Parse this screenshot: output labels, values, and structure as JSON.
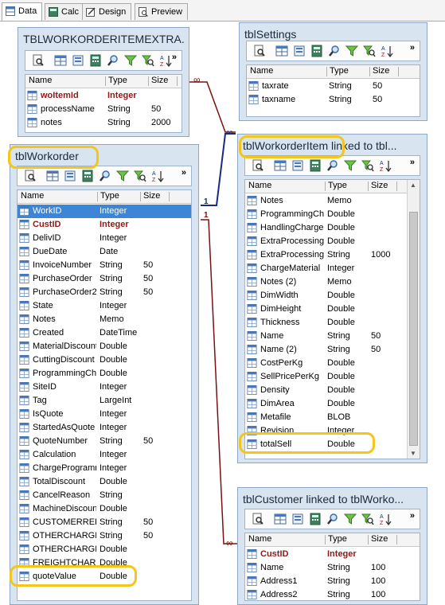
{
  "tabs": [
    {
      "label": "Data",
      "icon": "data-tab-icon"
    },
    {
      "label": "Calc",
      "icon": "calc-tab-icon"
    },
    {
      "label": "Design",
      "icon": "design-tab-icon"
    },
    {
      "label": "Preview",
      "icon": "preview-tab-icon"
    }
  ],
  "active_tab": "Data",
  "columns": {
    "name": "Name",
    "type": "Type",
    "size": "Size"
  },
  "toolbar_more": "»",
  "tables": {
    "itemextra": {
      "title": "TBLWORKORDERITEMEXTRA...",
      "rows": [
        {
          "name": "woItemId",
          "type": "Integer",
          "size": "",
          "key": true
        },
        {
          "name": "processName",
          "type": "String",
          "size": "50"
        },
        {
          "name": "notes",
          "type": "String",
          "size": "2000"
        }
      ]
    },
    "settings": {
      "title": "tblSettings",
      "rows": [
        {
          "name": "taxrate",
          "type": "String",
          "size": "50"
        },
        {
          "name": "taxname",
          "type": "String",
          "size": "50"
        }
      ]
    },
    "workorder": {
      "title": "tblWorkorder",
      "rows": [
        {
          "name": "WorkID",
          "type": "Integer",
          "size": "",
          "selected": true
        },
        {
          "name": "CustID",
          "type": "Integer",
          "size": "",
          "key": true
        },
        {
          "name": "DelivID",
          "type": "Integer",
          "size": ""
        },
        {
          "name": "DueDate",
          "type": "Date",
          "size": ""
        },
        {
          "name": "InvoiceNumber",
          "type": "String",
          "size": "50"
        },
        {
          "name": "PurchaseOrder",
          "type": "String",
          "size": "50"
        },
        {
          "name": "PurchaseOrder2",
          "type": "String",
          "size": "50"
        },
        {
          "name": "State",
          "type": "Integer",
          "size": ""
        },
        {
          "name": "Notes",
          "type": "Memo",
          "size": ""
        },
        {
          "name": "Created",
          "type": "DateTime",
          "size": ""
        },
        {
          "name": "MaterialDiscount",
          "type": "Double",
          "size": ""
        },
        {
          "name": "CuttingDiscount",
          "type": "Double",
          "size": ""
        },
        {
          "name": "ProgrammingCha",
          "type": "Double",
          "size": ""
        },
        {
          "name": "SiteID",
          "type": "Integer",
          "size": ""
        },
        {
          "name": "Tag",
          "type": "LargeInt",
          "size": ""
        },
        {
          "name": "IsQuote",
          "type": "Integer",
          "size": ""
        },
        {
          "name": "StartedAsQuote",
          "type": "Integer",
          "size": ""
        },
        {
          "name": "QuoteNumber",
          "type": "String",
          "size": "50"
        },
        {
          "name": "Calculation",
          "type": "Integer",
          "size": ""
        },
        {
          "name": "ChargeProgramm",
          "type": "Integer",
          "size": ""
        },
        {
          "name": "TotalDiscount",
          "type": "Double",
          "size": ""
        },
        {
          "name": "CancelReason",
          "type": "String",
          "size": ""
        },
        {
          "name": "MachineDiscount",
          "type": "Double",
          "size": ""
        },
        {
          "name": "CUSTOMERREF",
          "type": "String",
          "size": "50"
        },
        {
          "name": "OTHERCHARGES",
          "type": "String",
          "size": "50"
        },
        {
          "name": "OTHERCHARGES",
          "type": "Double",
          "size": ""
        },
        {
          "name": "FREIGHTCHARG",
          "type": "Double",
          "size": ""
        },
        {
          "name": "quoteValue",
          "type": "Double",
          "size": ""
        }
      ]
    },
    "workorderitem": {
      "title": "tblWorkorderItem linked to tbl...",
      "rows": [
        {
          "name": "Notes",
          "type": "Memo",
          "size": ""
        },
        {
          "name": "ProgrammingCha",
          "type": "Double",
          "size": ""
        },
        {
          "name": "HandlingCharge",
          "type": "Double",
          "size": ""
        },
        {
          "name": "ExtraProcessing",
          "type": "Double",
          "size": ""
        },
        {
          "name": "ExtraProcessing",
          "type": "String",
          "size": "1000"
        },
        {
          "name": "ChargeMaterial",
          "type": "Integer",
          "size": ""
        },
        {
          "name": "Notes (2)",
          "type": "Memo",
          "size": ""
        },
        {
          "name": "DimWidth",
          "type": "Double",
          "size": ""
        },
        {
          "name": "DimHeight",
          "type": "Double",
          "size": ""
        },
        {
          "name": "Thickness",
          "type": "Double",
          "size": ""
        },
        {
          "name": "Name",
          "type": "String",
          "size": "50"
        },
        {
          "name": "Name (2)",
          "type": "String",
          "size": "50"
        },
        {
          "name": "CostPerKg",
          "type": "Double",
          "size": ""
        },
        {
          "name": "SellPricePerKg",
          "type": "Double",
          "size": ""
        },
        {
          "name": "Density",
          "type": "Double",
          "size": ""
        },
        {
          "name": "DimArea",
          "type": "Double",
          "size": ""
        },
        {
          "name": "Metafile",
          "type": "BLOB",
          "size": ""
        },
        {
          "name": "Revision",
          "type": "Integer",
          "size": ""
        },
        {
          "name": "totalSell",
          "type": "Double",
          "size": ""
        }
      ]
    },
    "customer": {
      "title": "tblCustomer linked to tblWorko...",
      "rows": [
        {
          "name": "CustID",
          "type": "Integer",
          "size": "",
          "key": true
        },
        {
          "name": "Name",
          "type": "String",
          "size": "100"
        },
        {
          "name": "Address1",
          "type": "String",
          "size": "100"
        },
        {
          "name": "Address2",
          "type": "String",
          "size": "100"
        }
      ]
    }
  },
  "link_labels": {
    "one": "1",
    "many": "∞"
  },
  "colors": {
    "window_bg": "#d8e4f0",
    "highlight": "#f3c619",
    "selection": "#3d86d7",
    "key_text": "#8b1a1a",
    "link_line": "#7a1010"
  }
}
